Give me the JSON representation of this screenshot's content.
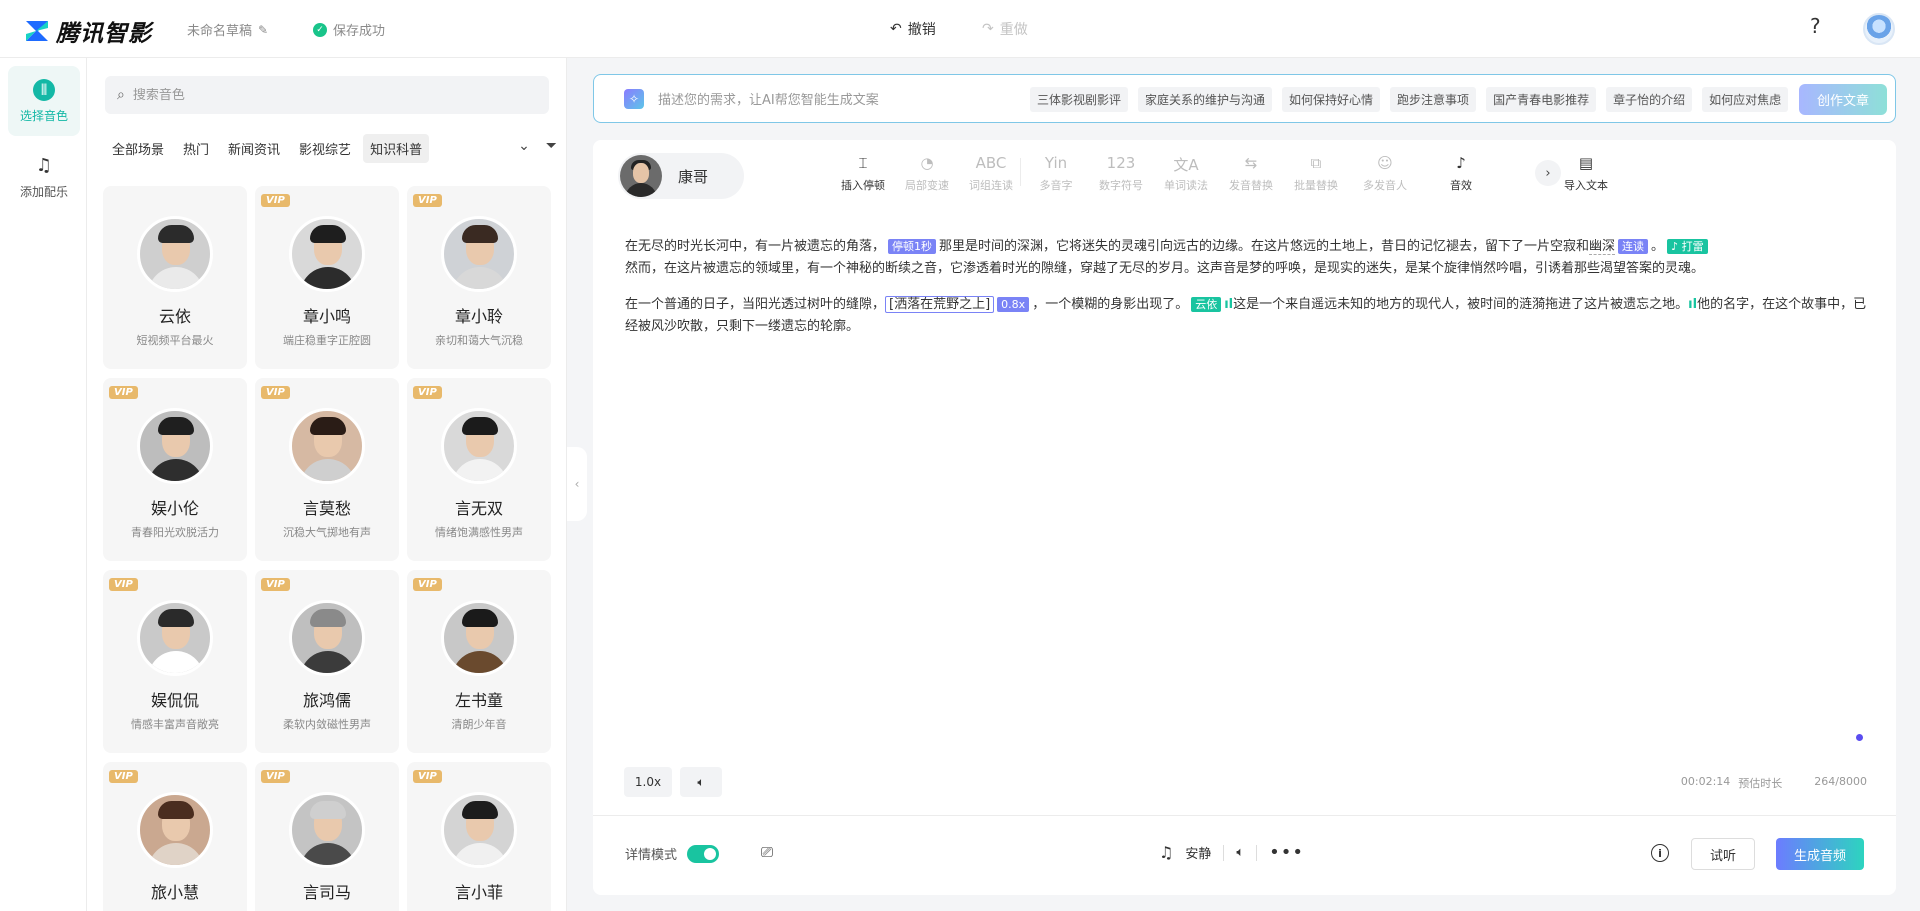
{
  "header": {
    "logo_text": "腾讯智影",
    "draft_name": "未命名草稿",
    "save_status": "保存成功",
    "undo_label": "撤销",
    "redo_label": "重做",
    "help_glyph": "?"
  },
  "rail": {
    "items": [
      {
        "label": "选择音色",
        "icon": "voice-waveform-icon",
        "active": true
      },
      {
        "label": "添加配乐",
        "icon": "music-note-icon",
        "active": false
      }
    ]
  },
  "voice_panel": {
    "search_placeholder": "搜索音色",
    "tabs": [
      "全部场景",
      "热门",
      "新闻资讯",
      "影视综艺",
      "知识科普"
    ],
    "active_tab": "知识科普",
    "vip_label": "VIP",
    "cards": [
      {
        "name": "云依",
        "desc": "短视频平台最火",
        "vip": false
      },
      {
        "name": "章小鸣",
        "desc": "端庄稳重字正腔圆",
        "vip": true
      },
      {
        "name": "章小聆",
        "desc": "亲切和蔼大气沉稳",
        "vip": true
      },
      {
        "name": "娱小伦",
        "desc": "青春阳光欢脱活力",
        "vip": true
      },
      {
        "name": "言莫愁",
        "desc": "沉稳大气掷地有声",
        "vip": true
      },
      {
        "name": "言无双",
        "desc": "情绪饱满感性男声",
        "vip": true
      },
      {
        "name": "娱侃侃",
        "desc": "情感丰富声音敞亮",
        "vip": true
      },
      {
        "name": "旅鸿儒",
        "desc": "柔软内敛磁性男声",
        "vip": true
      },
      {
        "name": "左书童",
        "desc": "清朗少年音",
        "vip": true
      },
      {
        "name": "旅小慧",
        "desc": "",
        "vip": true
      },
      {
        "name": "言司马",
        "desc": "",
        "vip": true
      },
      {
        "name": "言小菲",
        "desc": "",
        "vip": true
      }
    ]
  },
  "ai_bar": {
    "placeholder": "描述您的需求，让AI帮您智能生成文案",
    "chips": [
      "三体影视剧影评",
      "家庭关系的维护与沟通",
      "如何保持好心情",
      "跑步注意事项",
      "国产青春电影推荐",
      "章子怡的介绍",
      "如何应对焦虑"
    ],
    "create_label": "创作文章"
  },
  "editor": {
    "speaker_name": "康哥",
    "tools": [
      {
        "label": "插入停顿",
        "glyph": "⌶",
        "enabled": true
      },
      {
        "label": "局部变速",
        "glyph": "◔",
        "enabled": false
      },
      {
        "label": "词组连读",
        "glyph": "ABC",
        "enabled": false
      },
      {
        "label": "多音字",
        "glyph": "Yin",
        "enabled": false
      },
      {
        "label": "数字符号",
        "glyph": "123",
        "enabled": false
      },
      {
        "label": "单词读法",
        "glyph": "文A",
        "enabled": false
      },
      {
        "label": "发音替换",
        "glyph": "⇆",
        "enabled": false
      },
      {
        "label": "批量替换",
        "glyph": "⧉",
        "enabled": false
      },
      {
        "label": "多发音人",
        "glyph": "☺",
        "enabled": false
      },
      {
        "label": "音效",
        "glyph": "♪",
        "enabled": true
      },
      {
        "label": "导入文本",
        "glyph": "▤",
        "enabled": true
      }
    ],
    "paragraph1": {
      "seg1": "在无尽的时光长河中，有一片被遗忘的角落，",
      "pause_tag": "停顿1秒",
      "seg2": "那里是时间的深渊，它将迷失的灵魂引向远古的边缘。在这片悠远的土地上，昔日的记忆褪去，留下了一片空寂和",
      "link_word": "幽深",
      "link_tag": "连读",
      "seg3": "。",
      "fx_tag": "打雷",
      "seg4": "然而，在这片被遗忘的领域里，有一个神秘的断续之音，它渗透着时光的隙缝，穿越了无尽的岁月。这声音是梦的呼唤，是现实的迷失，是某个旋律悄然吟唱，引诱着那些渴望答案的灵魂。"
    },
    "paragraph2": {
      "seg1": "在一个普通的日子，当阳光透过树叶的缝隙，",
      "bracket_text": "[洒落在荒野之上]",
      "speed_tag": "0.8x",
      "seg2": "，一个模糊的身影出现了。",
      "voice_tag": "云依",
      "seg3": "这是一个来自遥远未知的地方的现代人，被时间的涟漪拖进了这片被遗忘之地。",
      "seg4": "他的名字，在这个故事中，已经被风沙吹散，只剩下一缕遗忘的轮廓。"
    },
    "speed_label": "1.0x",
    "duration": "00:02:14",
    "duration_label": "预估时长",
    "char_count": "264/8000",
    "detail_mode_label": "详情模式",
    "bgm_label": "安静",
    "try_label": "试听",
    "generate_label": "生成音频"
  },
  "colors": {
    "accent_teal": "#14b8a6",
    "tag_purple": "#7a83f6",
    "vip_gold": "#e8b96b"
  }
}
